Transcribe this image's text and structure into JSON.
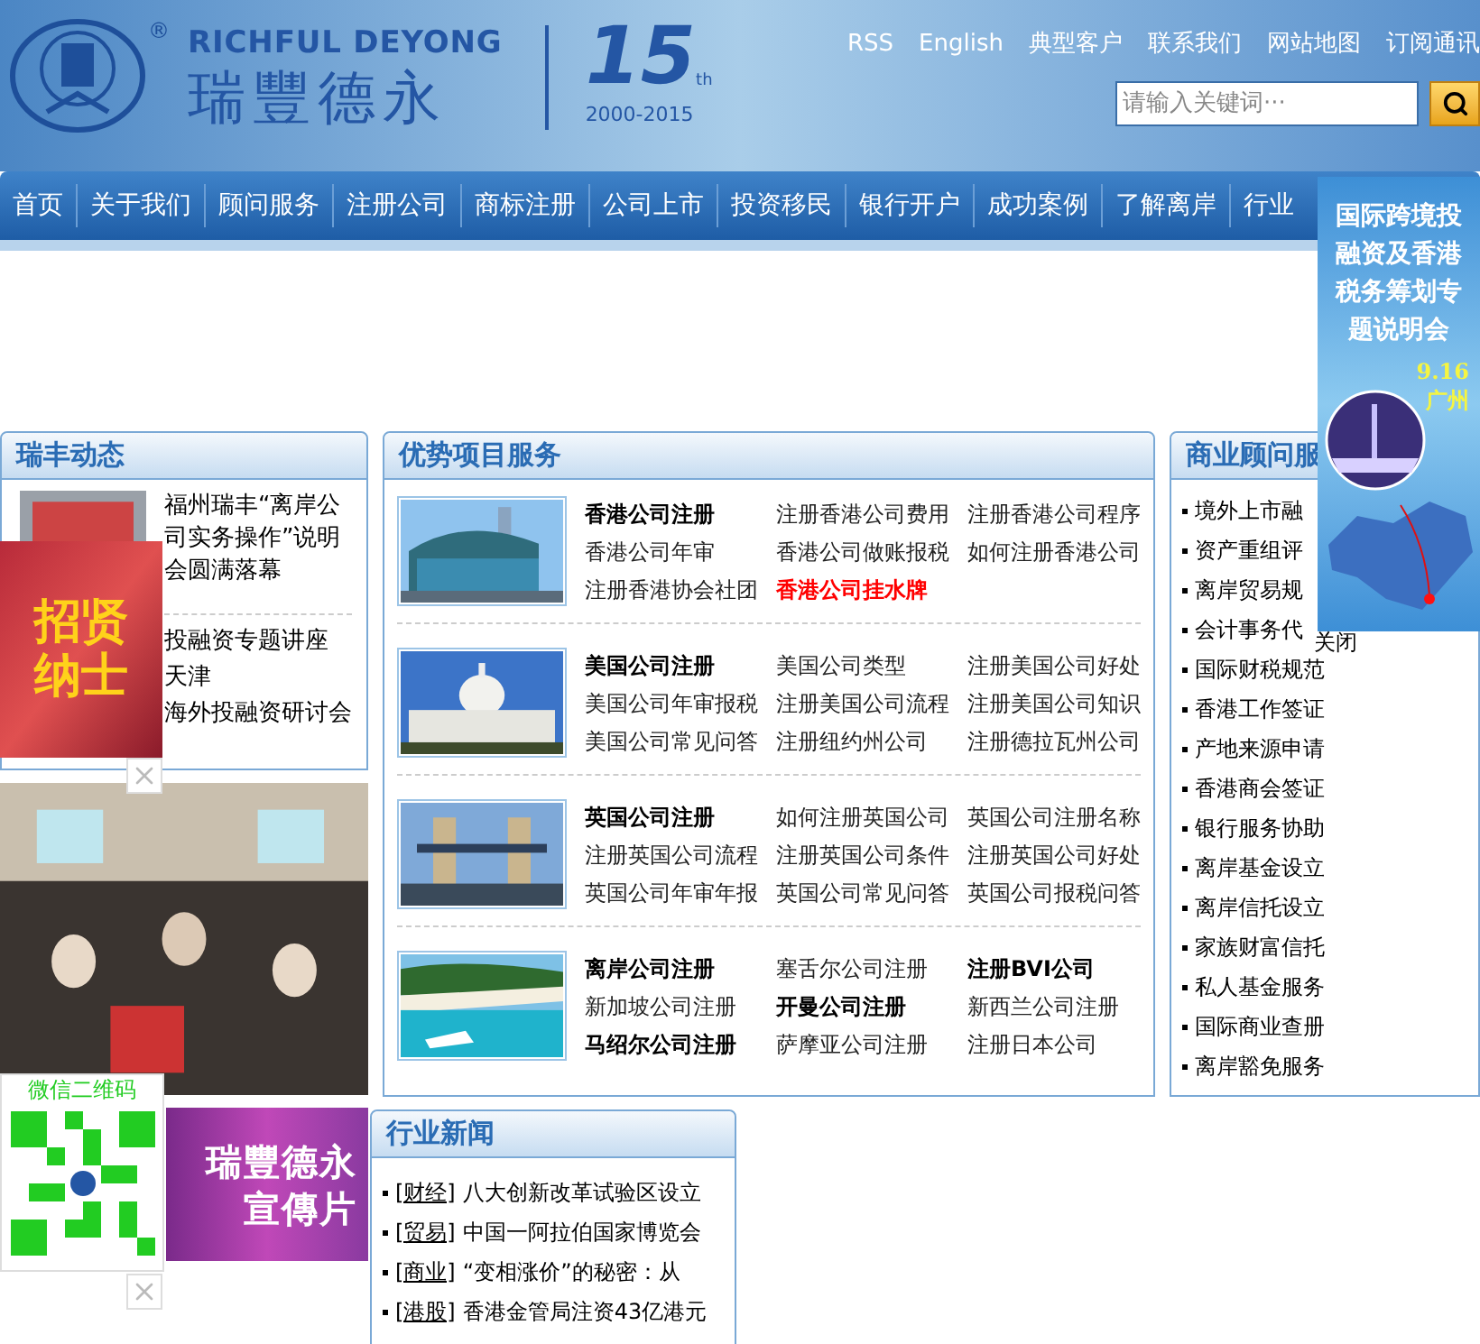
{
  "header": {
    "logo": {
      "name_en": "RICHFUL DEYONG",
      "name_cn": "瑞豐德永",
      "registered": "®",
      "anniversary": "15",
      "suffix": "th",
      "years": "2000-2015"
    },
    "top_links": [
      "RSS",
      "English",
      "典型客户",
      "联系我们",
      "网站地图",
      "订阅通讯"
    ],
    "search": {
      "placeholder": "请输入关键词···"
    }
  },
  "nav": [
    "首页",
    "关于我们",
    "顾问服务",
    "注册公司",
    "商标注册",
    "公司上市",
    "投资移民",
    "银行开户",
    "成功案例",
    "了解离岸",
    "行业"
  ],
  "news_panel": {
    "title": "瑞丰动态",
    "feature": "福州瑞丰“离岸公司实务操作”说明会圆满落幕",
    "items": [
      "投融资专题讲座",
      "天津",
      "海外投融资研讨会"
    ]
  },
  "services": {
    "title": "优势项目服务",
    "groups": [
      {
        "links": [
          {
            "text": "香港公司注册",
            "kind": "bold"
          },
          {
            "text": "注册香港公司费用",
            "kind": "plain"
          },
          {
            "text": "注册香港公司程序",
            "kind": "plain"
          },
          {
            "text": "香港公司年审",
            "kind": "plain"
          },
          {
            "text": "香港公司做账报税",
            "kind": "plain"
          },
          {
            "text": "如何注册香港公司",
            "kind": "plain"
          },
          {
            "text": "注册香港协会社团",
            "kind": "plain"
          },
          {
            "text": "香港公司挂水牌",
            "kind": "hot"
          }
        ]
      },
      {
        "links": [
          {
            "text": "美国公司注册",
            "kind": "bold"
          },
          {
            "text": "美国公司类型",
            "kind": "plain"
          },
          {
            "text": "注册美国公司好处",
            "kind": "plain"
          },
          {
            "text": "美国公司年审报税",
            "kind": "plain"
          },
          {
            "text": "注册美国公司流程",
            "kind": "plain"
          },
          {
            "text": "注册美国公司知识",
            "kind": "plain"
          },
          {
            "text": "美国公司常见问答",
            "kind": "plain"
          },
          {
            "text": "注册纽约州公司",
            "kind": "plain"
          },
          {
            "text": "注册德拉瓦州公司",
            "kind": "plain"
          }
        ]
      },
      {
        "links": [
          {
            "text": "英国公司注册",
            "kind": "bold"
          },
          {
            "text": "如何注册英国公司",
            "kind": "plain"
          },
          {
            "text": "英国公司注册名称",
            "kind": "plain"
          },
          {
            "text": "注册英国公司流程",
            "kind": "plain"
          },
          {
            "text": "注册英国公司条件",
            "kind": "plain"
          },
          {
            "text": "注册英国公司好处",
            "kind": "plain"
          },
          {
            "text": "英国公司年审年报",
            "kind": "plain"
          },
          {
            "text": "英国公司常见问答",
            "kind": "plain"
          },
          {
            "text": "英国公司报税问答",
            "kind": "plain"
          }
        ]
      },
      {
        "links": [
          {
            "text": "离岸公司注册",
            "kind": "bold"
          },
          {
            "text": "塞舌尔公司注册",
            "kind": "plain"
          },
          {
            "text": "注册BVI公司",
            "kind": "bold"
          },
          {
            "text": "新加坡公司注册",
            "kind": "plain"
          },
          {
            "text": "开曼公司注册",
            "kind": "bold"
          },
          {
            "text": "新西兰公司注册",
            "kind": "plain"
          },
          {
            "text": "马绍尔公司注册",
            "kind": "bold"
          },
          {
            "text": "萨摩亚公司注册",
            "kind": "plain"
          },
          {
            "text": "注册日本公司",
            "kind": "plain"
          }
        ]
      }
    ]
  },
  "business": {
    "title": "商业顾问服",
    "items": [
      "境外上市融",
      "资产重组评",
      "离岸贸易规",
      "会计事务代",
      "国际财税规范",
      "香港工作签证",
      "产地来源申请",
      "香港商会签证",
      "银行服务协助",
      "离岸基金设立",
      "离岸信托设立",
      "家族财富信托",
      "私人基金服务",
      "国际商业查册",
      "离岸豁免服务"
    ]
  },
  "industry_news": {
    "title": "行业新闻",
    "items": [
      {
        "tag": "[财经]",
        "text": "八大创新改革试验区设立"
      },
      {
        "tag": "[贸易]",
        "text": "中国一阿拉伯国家博览会"
      },
      {
        "tag": "[商业]",
        "text": "“变相涨价”的秘密：从"
      },
      {
        "tag": "[港股]",
        "text": "香港金管局注资43亿港元"
      }
    ]
  },
  "float_ad_left": {
    "text": "招贤纳士"
  },
  "qr_float": {
    "label": "微信二维码"
  },
  "promo": {
    "lines": [
      "瑞豐德永",
      "宣傳片"
    ]
  },
  "float_ad_right": {
    "lines": [
      "国际跨境投",
      "融资及香港",
      "税务筹划专",
      "题说明会"
    ],
    "date": "9.16",
    "city": "广州",
    "close": "关闭"
  }
}
